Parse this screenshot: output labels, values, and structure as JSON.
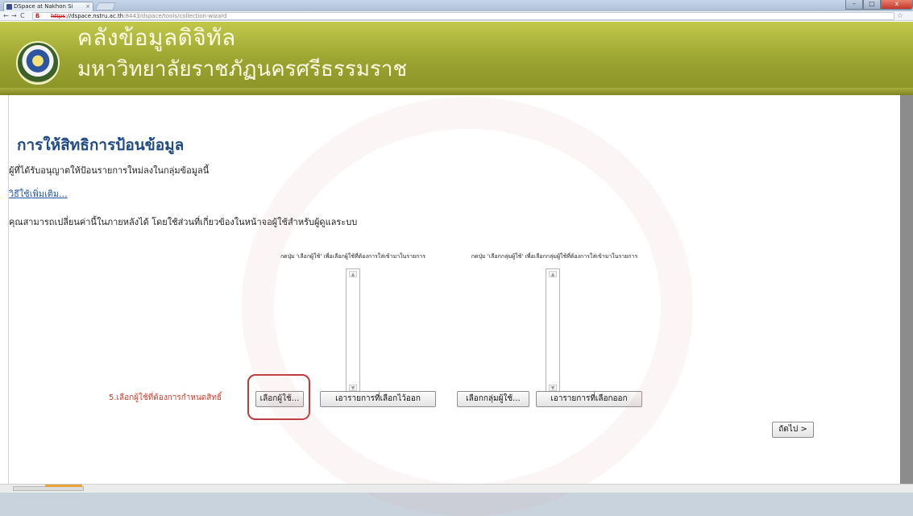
{
  "browser": {
    "tab_title": "DSpace at Nakhon Si",
    "tab_close": "×",
    "nav_back": "←",
    "nav_forward": "→",
    "nav_reload": "C",
    "url_scheme": "https",
    "url_host": "://dspace.nstru.ac.th",
    "url_path": ":8443/dspace/tools/collection-wizard",
    "bookmark_star": "☆",
    "win_minimize": "–",
    "win_maximize": "□",
    "win_close": "x"
  },
  "banner": {
    "title": "คลังข้อมูลดิจิทัล",
    "subtitle": "มหาวิทยาลัยราชภัฏนครศรีธรรมราช"
  },
  "main": {
    "page_title": "การให้สิทธิการป้อนข้อมูล",
    "description": "ผู้ที่ได้รับอนุญาตให้ป้อนรายการใหม่ลงในกลุ่มข้อมูลนี้",
    "help_link": "วิธีใช้เพิ่มเติม...",
    "note": "คุณสามารถเปลี่ยนค่านี้ในภายหลังได้ โดยใช้ส่วนที่เกี่ยวข้องในหน้าจอผู้ใช้สำหรับผู้ดูแลระบบ",
    "epeople_hint": "กดปุ่ม 'เลือกผู้ใช้' เพื่อเลือกผู้ใช้ที่ต้องการใส่เข้ามาในรายการ",
    "groups_hint": "กดปุ่ม 'เลือกกลุ่มผู้ใช้' เพื่อเลือกกลุ่มผู้ใช้ที่ต้องการใส่เข้ามาในรายการ",
    "annotation": "5.เลือกผู้ใช้ที่ต้องการกำหนดสิทธิ์",
    "buttons": {
      "select_epeople": "เลือกผู้ใช้...",
      "remove_selected_epeople": "เอารายการที่เลือกไว้ออก",
      "select_groups": "เลือกกลุ่มผู้ใช้...",
      "remove_selected_groups": "เอารายการที่เลือกออก",
      "next": "ถัดไป >"
    }
  }
}
